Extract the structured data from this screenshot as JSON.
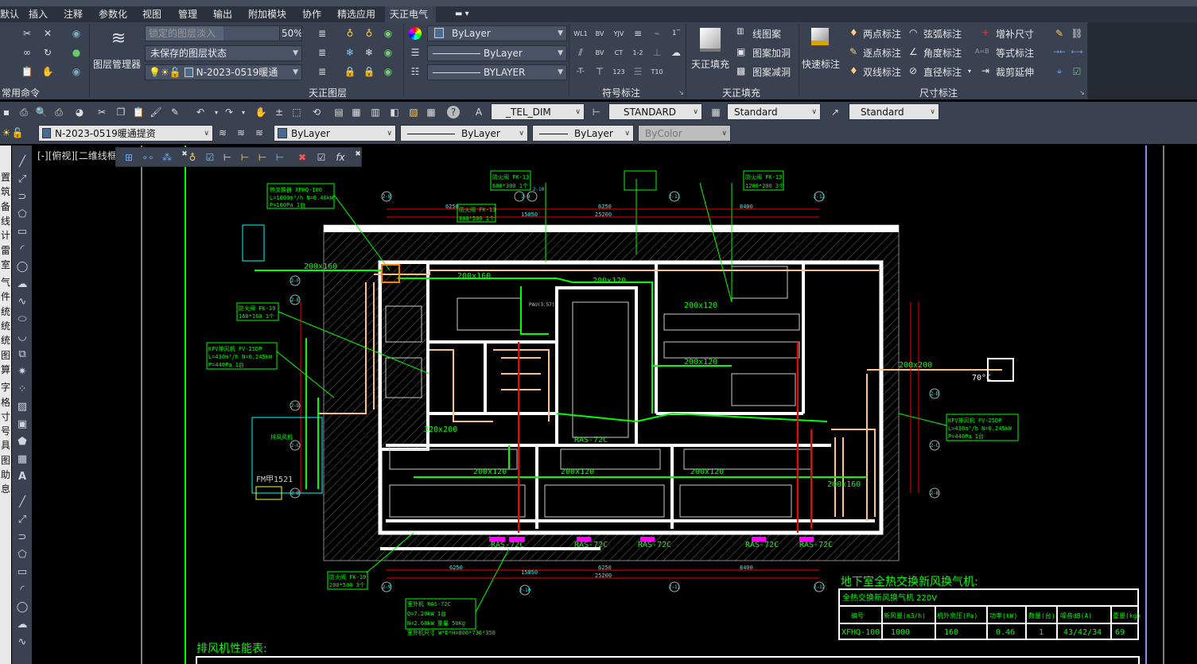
{
  "tabs": [
    "默认",
    "插入",
    "注释",
    "参数化",
    "视图",
    "管理",
    "输出",
    "附加模块",
    "协作",
    "精选应用",
    "天正电气"
  ],
  "active_tab": "天正电气",
  "ribbon": {
    "panels": [
      "常用命令",
      "天正图层",
      "符号标注",
      "天正填充",
      "尺寸标注"
    ],
    "layer_manager": "图层管理器",
    "locked_fade_label": "锁定的图层淡入",
    "locked_fade_value": "50%",
    "locked_fade_percent": 50,
    "layer_state": "未保存的图层状态",
    "current_layer": "N-2023-0519暖通",
    "color": "ByLayer",
    "linetype": "ByLayer",
    "lineweight": "BYLAYER",
    "fill_button": "天正填充",
    "fill_items": [
      "线图案",
      "图案加洞",
      "图案减洞"
    ],
    "quick_dim": "快速标注",
    "dim_items": [
      "两点标注",
      "逐点标注",
      "双线标注",
      "弦弧标注",
      "角度标注",
      "直径标注",
      "增补尺寸",
      "等式标注",
      "裁剪延伸"
    ]
  },
  "toolbar1": {
    "text_style": "_TEL_DIM",
    "dim_style": "STANDARD",
    "table_style": "Standard",
    "mleader_style": "Standard"
  },
  "toolbar2": {
    "layer": "N-2023-0519暖通提资",
    "color": "ByLayer",
    "linetype": "ByLayer",
    "lineweight": "ByLayer",
    "plotstyle": "ByColor"
  },
  "left_strip": [
    "置",
    "筑",
    "备",
    "线",
    "计",
    "雷",
    "室",
    "气",
    "件",
    "统",
    "统",
    "统",
    "图",
    "算",
    "字",
    "格",
    "寸",
    "号",
    "具",
    "图",
    "助",
    "息"
  ],
  "viewport_label": "[-][俯视][二维线框]",
  "drawing": {
    "labels": [
      "200x160",
      "200x160",
      "200x120",
      "200x120",
      "200x120",
      "200x120",
      "200x120",
      "200x160",
      "200x200",
      "320x200",
      "200x120",
      "RAS-72C",
      "RAS-72C",
      "RAS-72C",
      "RAS-72C",
      "RAS-72C",
      "RAS-72C",
      "70°C",
      "FM甲1521",
      "排风风机",
      "PAU(3.57)"
    ],
    "tags": [
      {
        "l1": "热交换器 XFHQ-100",
        "l2": "L=1000m³/h N=0.46kW",
        "l3": "P=160Pa 1台"
      },
      {
        "l1": "防火阀 FK-13",
        "l2": "600*300 1个"
      },
      {
        "l1": "防火阀 FK-13",
        "l2": "800*500 1个"
      },
      {
        "l1": "防火阀 FK-13",
        "l2": "1200*200 3个"
      },
      {
        "l1": "防火阀 FK-19",
        "l2": "160*160 1个"
      },
      {
        "l1": "KFV排风机 FV-25DP",
        "l2": "L=430m³/h N=0.245kW",
        "l3": "P=440Pa 1台"
      },
      {
        "l1": "KFV排风机 FV-25DP",
        "l2": "L=430m³/h N=0.245kW",
        "l3": "P=440Pa 1台"
      },
      {
        "l1": "防火阀 FK-19",
        "l2": "200*500 3个"
      },
      {
        "l1": "室外机 RAS-72C",
        "l2": "Q=7.20kW 1台",
        "l3": "N=2.68kW 重量 50Kg",
        "l4": "室外机尺寸 W*D*H=800*736*350"
      }
    ],
    "dims": {
      "top": [
        "6250",
        "6250",
        "8400",
        "25200",
        "15050"
      ],
      "bottom": [
        "6250",
        "6250",
        "8400",
        "25200",
        "15050"
      ]
    },
    "axes_top": [
      "2-8",
      "2-9",
      "2-10",
      "2-11",
      "2-12"
    ],
    "axes_bottom": [
      "2-9",
      "2-10",
      "2-11",
      "2-12"
    ],
    "axes_left": [
      "2-F",
      "2-E",
      "2-D",
      "2-C",
      "2-B"
    ],
    "axes_right": [
      "2-D",
      "2-C",
      "2-B"
    ]
  },
  "fresh_air_table": {
    "title": "地下室全热交换新风换气机:",
    "subtitle": "全热交换新风换气机    220V",
    "headers": [
      "编号",
      "新风量(m3/h)",
      "机外余压(Pa)",
      "功率(kW)",
      "数量(台)",
      "噪音dB(A)",
      "重量(kg)"
    ],
    "row": [
      "XFHQ-100",
      "1000",
      "160",
      "0.46",
      "1",
      "43/42/34",
      "69"
    ]
  },
  "exhaust_table": {
    "title": "排风机性能表:"
  },
  "colors": {
    "cad_green": "#00ff00",
    "duct_orange": "#ffc080",
    "dim_red": "#ff0000",
    "axis_cyan": "#00ffff",
    "magenta": "#ff00ff",
    "ribbon_bg": "#3a4150"
  }
}
